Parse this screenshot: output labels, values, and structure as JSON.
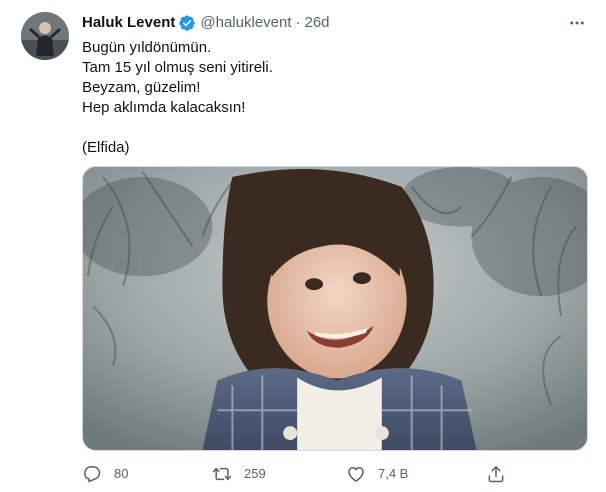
{
  "tweet": {
    "author": {
      "display_name": "Haluk Levent",
      "handle": "@haluklevent",
      "verified": true,
      "avatar_icon": "user-avatar"
    },
    "separator": "·",
    "time": "26d",
    "text_lines": [
      "Bugün yıldönümün.",
      "Tam 15 yıl olmuş seni yitireli.",
      "Beyzam, güzelim!",
      "Hep aklımda kalacaksın!",
      "",
      "(Elfida)"
    ],
    "media": {
      "kind": "photo"
    },
    "actions": {
      "reply": {
        "icon": "reply-icon",
        "count": "80"
      },
      "retweet": {
        "icon": "retweet-icon",
        "count": "259"
      },
      "like": {
        "icon": "like-icon",
        "count": "7,4 B"
      },
      "share": {
        "icon": "share-icon"
      }
    },
    "more_icon": "more-icon"
  },
  "colors": {
    "text_primary": "#0f1419",
    "text_secondary": "#536471",
    "verified_badge": "#1d9bf0",
    "border": "#cfd9de"
  }
}
